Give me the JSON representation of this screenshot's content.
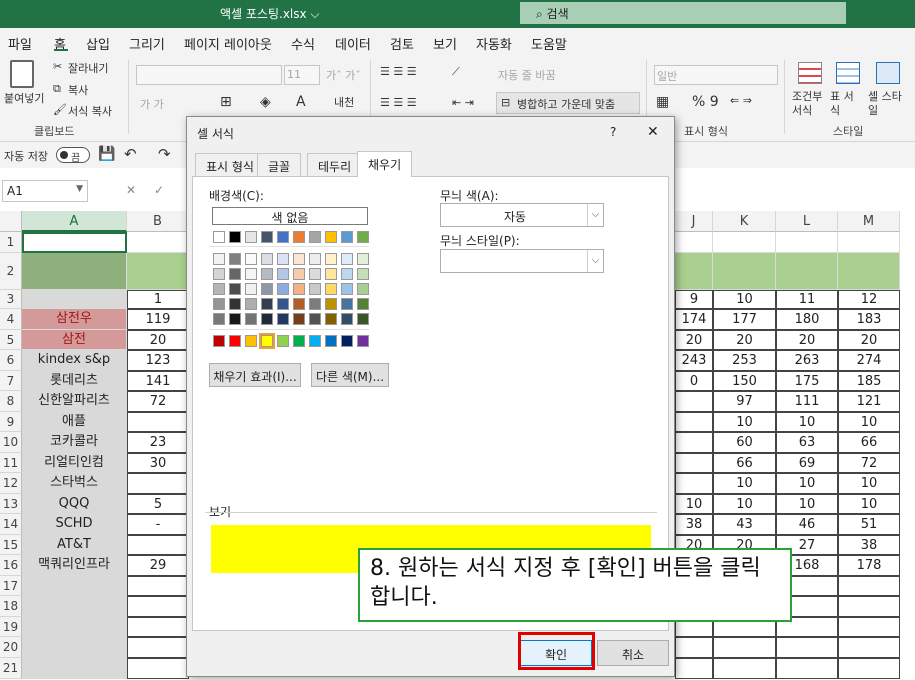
{
  "titlebar": {
    "filename": "액셀 포스팅.xlsx ⌵",
    "search": "검색"
  },
  "menu": [
    "파일",
    "홈",
    "삽입",
    "그리기",
    "페이지 레이아웃",
    "수식",
    "데이터",
    "검토",
    "보기",
    "자동화",
    "도움말"
  ],
  "ribbon": {
    "paste": "붙여넣기",
    "cut": "잘라내기",
    "copy": "복사",
    "format_painter": "서식 복사",
    "clipboard": "클립보드",
    "font_size": "11",
    "grow_shrink": "가ˆ 가ˇ",
    "bold_italic": "가  가",
    "wrap_text": "자동 줄 바꿈",
    "merge_center": "병합하고 가운데 맞춤",
    "number_format": "일반",
    "currency": "% 9",
    "number_group": "표시 형식",
    "cond_format": "조건부 서식",
    "table_format": "표 서식",
    "cell_style": "셀 스타일",
    "style_group": "스타일"
  },
  "qat": {
    "autosave": "자동 저장",
    "toggle": "끔"
  },
  "formula": {
    "namebox": "A1",
    "cancel": "✕",
    "confirm": "✓"
  },
  "columns": [
    "A",
    "B",
    "J",
    "K",
    "L",
    "M"
  ],
  "rows": [
    "1",
    "2",
    "3",
    "4",
    "5",
    "6",
    "7",
    "8",
    "9",
    "10",
    "11",
    "12",
    "13",
    "14",
    "15",
    "16",
    "17",
    "18",
    "19",
    "20",
    "21"
  ],
  "col_a": [
    "",
    "",
    "",
    "삼전우",
    "삼전",
    "kindex s&p",
    "롯데리츠",
    "신한알파리츠",
    "애플",
    "코카콜라",
    "리얼티인컴",
    "스타벅스",
    "QQQ",
    "SCHD",
    "AT&T",
    "맥쿼리인프라"
  ],
  "col_b": [
    "",
    "",
    "1",
    "119",
    "20",
    "123",
    "141",
    "72",
    "",
    "23",
    "30",
    "",
    "5",
    "-",
    "",
    "29"
  ],
  "col_j": [
    "",
    "",
    "9",
    "174",
    "20",
    "243",
    "0",
    "",
    "",
    "",
    "",
    "",
    "10",
    "38",
    "20",
    ""
  ],
  "col_k": [
    "",
    "",
    "10",
    "177",
    "20",
    "253",
    "150",
    "97",
    "10",
    "60",
    "66",
    "10",
    "10",
    "43",
    "20",
    ""
  ],
  "col_l": [
    "",
    "",
    "11",
    "180",
    "20",
    "263",
    "175",
    "111",
    "10",
    "63",
    "69",
    "10",
    "10",
    "46",
    "27",
    "168"
  ],
  "col_m": [
    "",
    "",
    "12",
    "183",
    "20",
    "274",
    "185",
    "121",
    "10",
    "66",
    "72",
    "10",
    "10",
    "51",
    "38",
    "178"
  ],
  "dialog": {
    "title": "셀 서식",
    "help": "?",
    "close": "✕",
    "tabs": [
      "표시 형식",
      "글꼴",
      "테두리",
      "채우기"
    ],
    "bg_color_label": "배경색(C):",
    "no_color": "색 없음",
    "fill_effects": "채우기 효과(I)...",
    "more_colors": "다른 색(M)...",
    "pattern_color_label": "무늬 색(A):",
    "pattern_color_value": "자동",
    "pattern_style_label": "무늬 스타일(P):",
    "preview_label": "보기",
    "ok": "확인",
    "cancel": "취소"
  },
  "colors": {
    "accent": "#217346",
    "preview_fill": "#ffff00",
    "theme_row": [
      "#ffffff",
      "#000000",
      "#e7e6e6",
      "#44546a",
      "#4472c4",
      "#ed7d31",
      "#a5a5a5",
      "#ffc000",
      "#5b9bd5",
      "#70ad47"
    ],
    "standard_row": [
      "#c00000",
      "#ff0000",
      "#ffc000",
      "#ffff00",
      "#92d050",
      "#00b050",
      "#00b0f0",
      "#0070c0",
      "#002060",
      "#7030a0"
    ]
  },
  "annotation": "8. 원하는 서식 지정 후 [확인] 버튼을 클릭합니다."
}
